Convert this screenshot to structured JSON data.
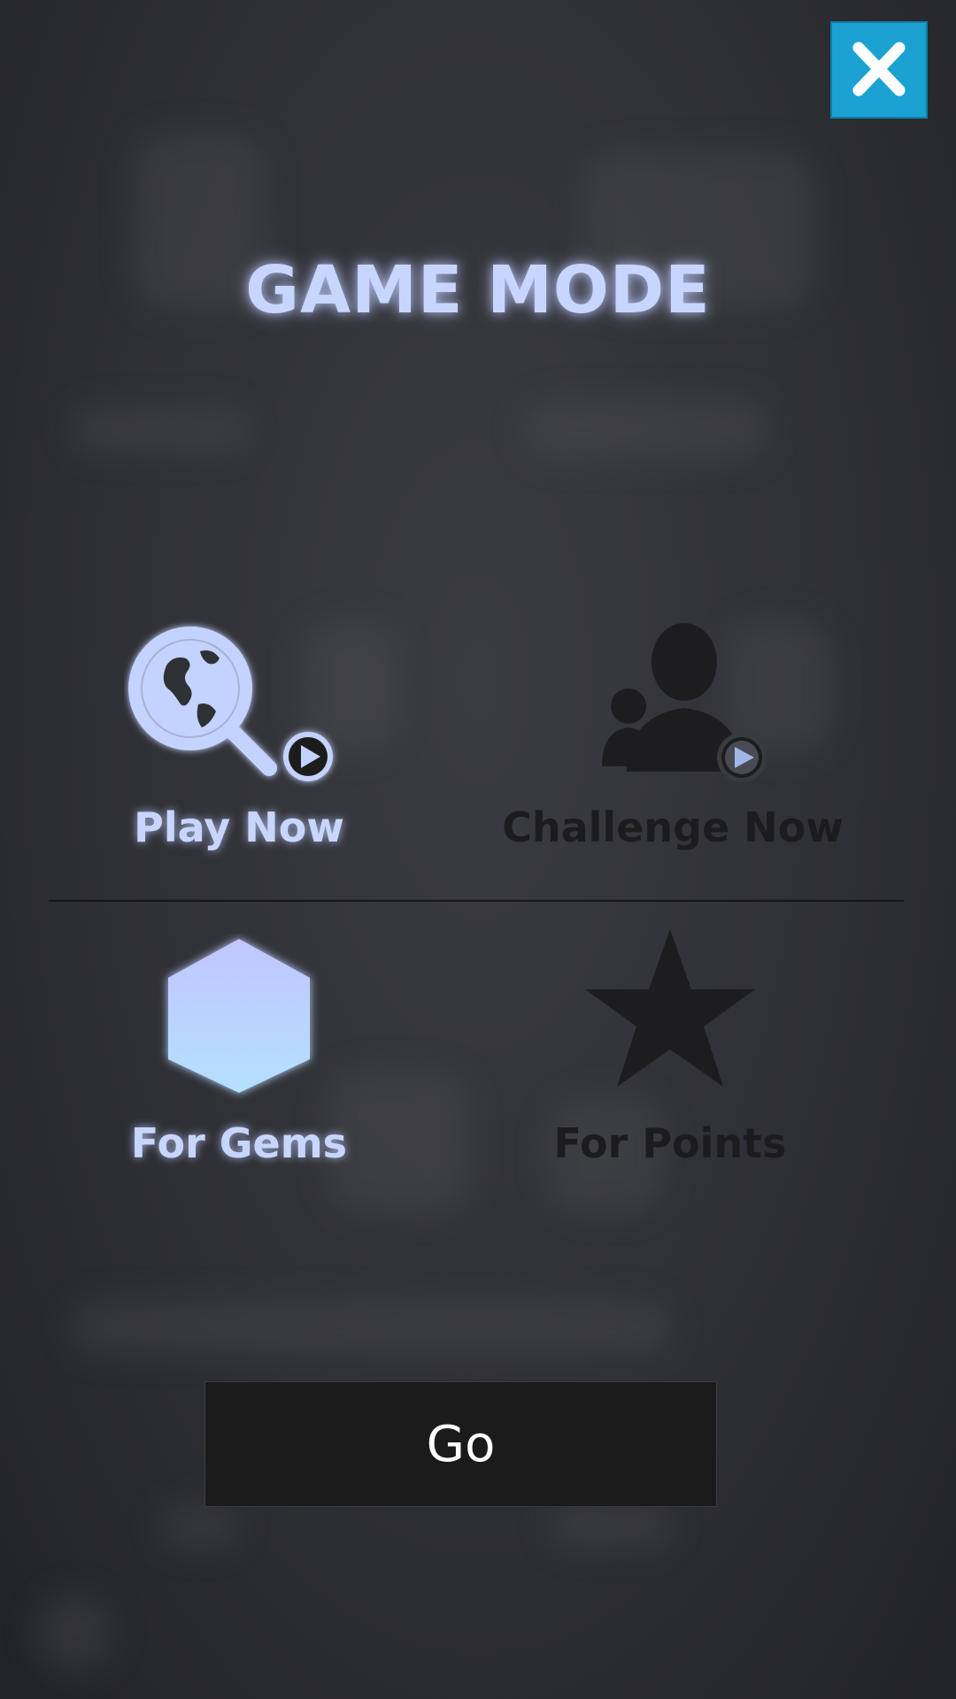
{
  "title": "GAME MODE",
  "close_button": {
    "icon": "close-icon",
    "color": "#1ba1d2"
  },
  "opponent_options": [
    {
      "label": "Play Now",
      "icon": "globe-search-icon",
      "selected": true
    },
    {
      "label": "Challenge Now",
      "icon": "users-challenge-icon",
      "selected": false
    }
  ],
  "reward_options": [
    {
      "label": "For Gems",
      "icon": "gem-icon",
      "selected": true
    },
    {
      "label": "For Points",
      "icon": "star-icon",
      "selected": false
    }
  ],
  "go_button": {
    "label": "Go"
  },
  "colors": {
    "active": "#c8d6ff",
    "inactive": "#1c1c1e",
    "accent": "#1ba1d2"
  }
}
